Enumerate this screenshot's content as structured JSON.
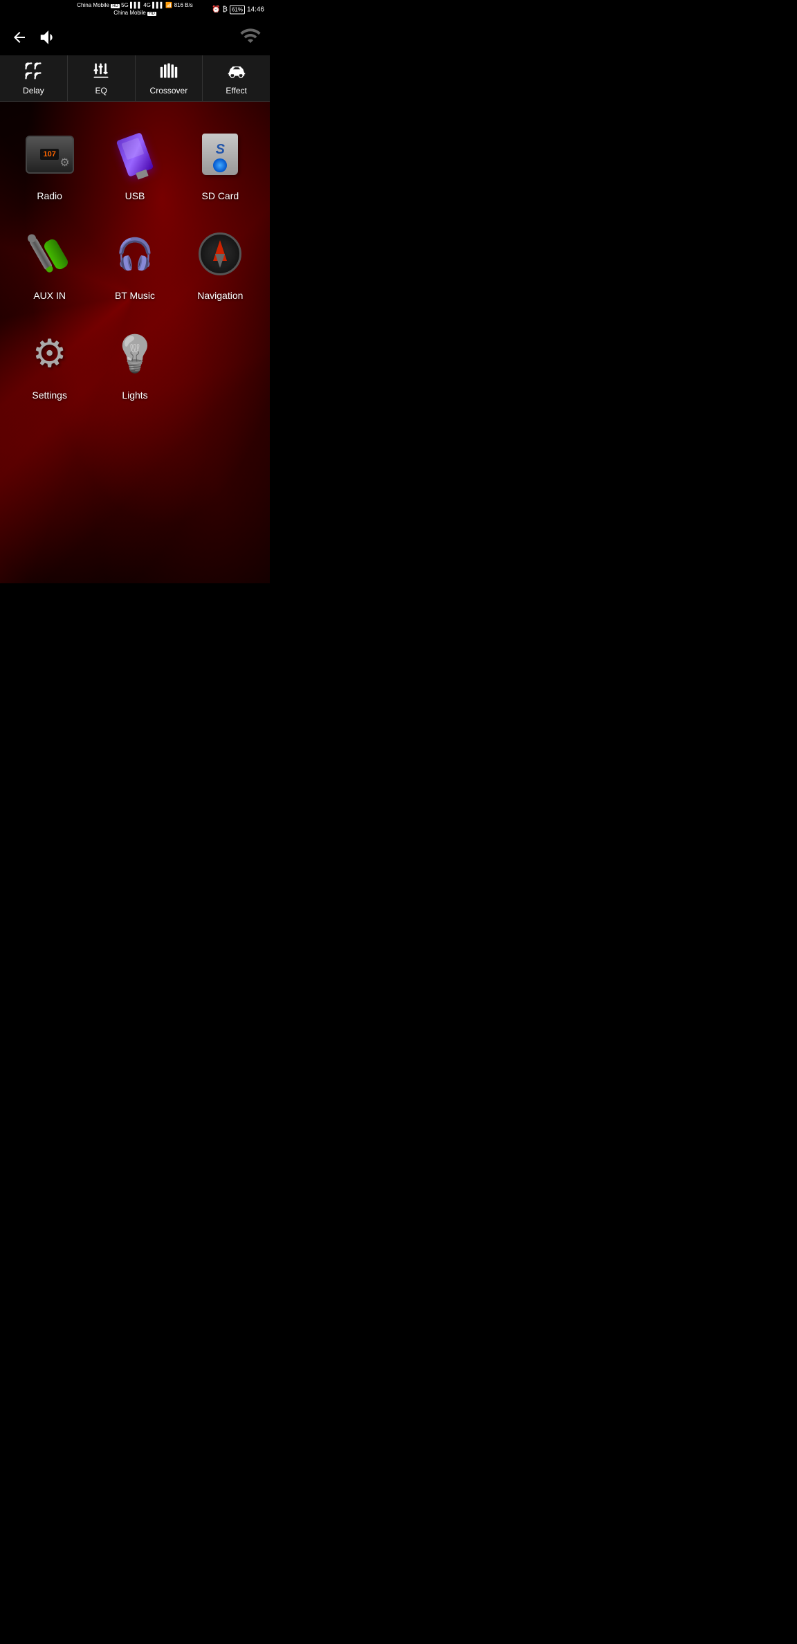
{
  "statusBar": {
    "carrier1": "China Mobile",
    "carrier1Tag": "HD",
    "carrier2": "China Mobile",
    "carrier2Tag": "HD",
    "networkSpeed": "816\nB/s",
    "time": "14:46",
    "batteryLevel": "61"
  },
  "header": {
    "backLabel": "←",
    "volumeLabel": "🔊"
  },
  "tabs": [
    {
      "id": "delay",
      "label": "Delay",
      "icon": "delay"
    },
    {
      "id": "eq",
      "label": "EQ",
      "icon": "eq"
    },
    {
      "id": "crossover",
      "label": "Crossover",
      "icon": "crossover"
    },
    {
      "id": "effect",
      "label": "Effect",
      "icon": "effect"
    }
  ],
  "appGrid": {
    "row1": [
      {
        "id": "radio",
        "label": "Radio"
      },
      {
        "id": "usb",
        "label": "USB"
      },
      {
        "id": "sdcard",
        "label": "SD Card"
      }
    ],
    "row2": [
      {
        "id": "auxin",
        "label": "AUX IN"
      },
      {
        "id": "btmusic",
        "label": "BT Music"
      },
      {
        "id": "navigation",
        "label": "Navigation"
      }
    ],
    "row3": [
      {
        "id": "settings",
        "label": "Settings"
      },
      {
        "id": "lights",
        "label": "Lights"
      }
    ]
  }
}
